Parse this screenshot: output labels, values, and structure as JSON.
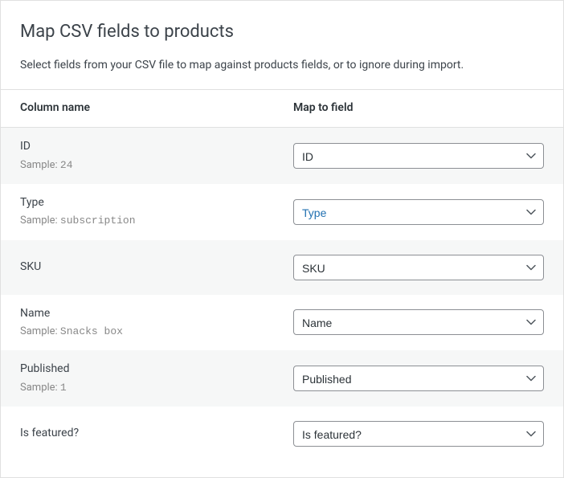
{
  "header": {
    "title": "Map CSV fields to products",
    "subtitle": "Select fields from your CSV file to map against products fields, or to ignore during import."
  },
  "tableHeaders": {
    "columnName": "Column name",
    "mapToField": "Map to field"
  },
  "sampleLabel": "Sample:",
  "rows": [
    {
      "label": "ID",
      "sample": "24",
      "selected": "ID",
      "active": false,
      "hasSample": true
    },
    {
      "label": "Type",
      "sample": "subscription",
      "selected": "Type",
      "active": true,
      "hasSample": true
    },
    {
      "label": "SKU",
      "sample": "",
      "selected": "SKU",
      "active": false,
      "hasSample": false
    },
    {
      "label": "Name",
      "sample": "Snacks box",
      "selected": "Name",
      "active": false,
      "hasSample": true
    },
    {
      "label": "Published",
      "sample": "1",
      "selected": "Published",
      "active": false,
      "hasSample": true
    },
    {
      "label": "Is featured?",
      "sample": "",
      "selected": "Is featured?",
      "active": false,
      "hasSample": false
    }
  ]
}
